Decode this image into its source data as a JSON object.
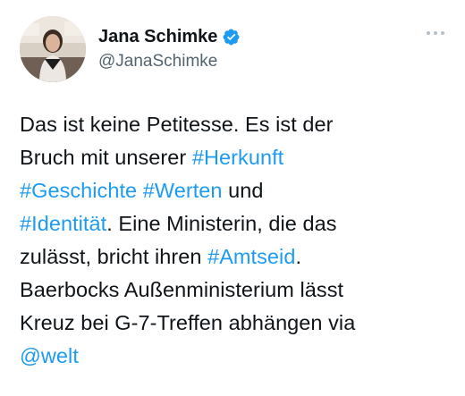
{
  "author": {
    "display_name": "Jana Schimke",
    "handle": "@JanaSchimke",
    "verified": true,
    "avatar_icon": "profile-photo",
    "verified_icon": "verified-badge-icon",
    "more_icon": "more-options-icon"
  },
  "colors": {
    "link": "#1d9bf0",
    "text": "#0f1419",
    "secondary": "#536471",
    "background": "#ffffff"
  },
  "tweet": {
    "line1": {
      "text_a": "Das ist keine Petitesse. Es ist der"
    },
    "line2": {
      "text_a": "Bruch mit unserer ",
      "tag_a": "#Herkunft"
    },
    "line3": {
      "tag_a": "#Geschichte",
      "space": " ",
      "tag_b": "#Werten",
      "text_a": " und"
    },
    "line4": {
      "tag_a": "#Identität",
      "text_a": ". Eine Ministerin, die das"
    },
    "line5": {
      "text_a": "zulässt, bricht ihren ",
      "tag_a": "#Amtseid",
      "text_b": "."
    },
    "line6": {
      "text_a": "Baerbocks Außenministerium lässt"
    },
    "line7": {
      "text_a": "Kreuz bei G-7-Treffen abhängen via"
    },
    "line8": {
      "mention": "@welt"
    }
  }
}
